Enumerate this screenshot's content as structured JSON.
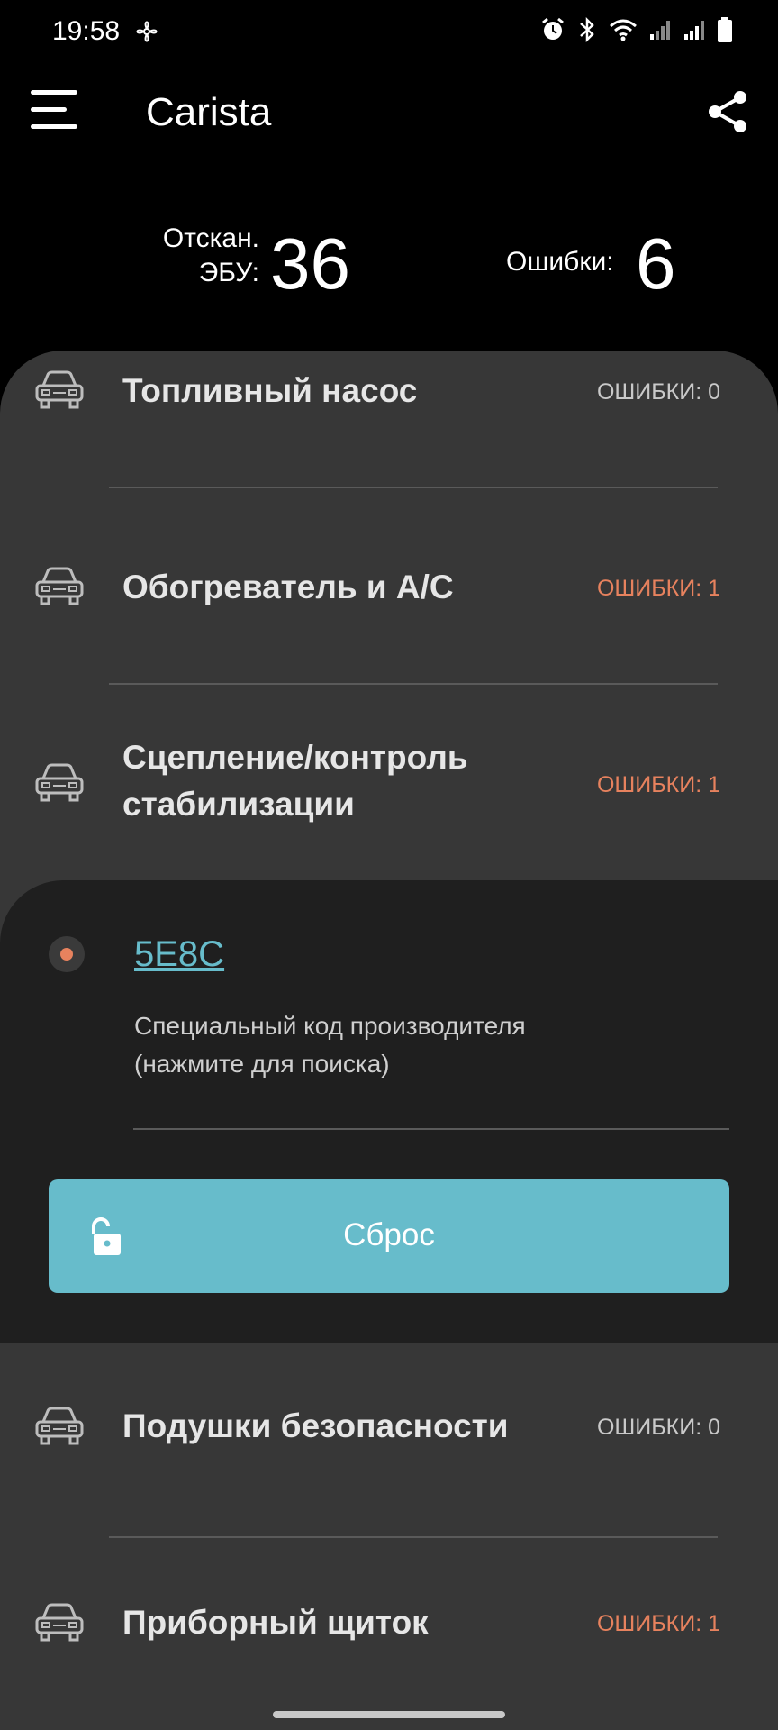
{
  "status_bar": {
    "time": "19:58"
  },
  "app_bar": {
    "title": "Carista"
  },
  "summary": {
    "scanned_label_line1": "Отскан.",
    "scanned_label_line2": "ЭБУ:",
    "scanned_value": "36",
    "errors_label": "Ошибки:",
    "errors_value": "6"
  },
  "modules": [
    {
      "name": "Топливный насос",
      "errors": "ОШИБКИ: 0"
    },
    {
      "name": "Обогреватель и A/C",
      "errors": "ОШИБКИ: 1"
    },
    {
      "name_line1": "Сцепление/контроль",
      "name_line2": "стабилизации",
      "errors": "ОШИБКИ: 1"
    },
    {
      "name": "Подушки безопасности",
      "errors": "ОШИБКИ: 0"
    },
    {
      "name": "Приборный щиток",
      "errors": "ОШИБКИ: 1"
    }
  ],
  "expanded": {
    "code": "5E8C",
    "description_line1": "Специальный код производителя",
    "description_line2": "(нажмите для поиска)",
    "reset_label": "Сброс"
  },
  "colors": {
    "error_accent": "#e7825e",
    "primary": "#67bccb",
    "panel_bg": "#373737",
    "expanded_bg": "#1f1f1f"
  }
}
